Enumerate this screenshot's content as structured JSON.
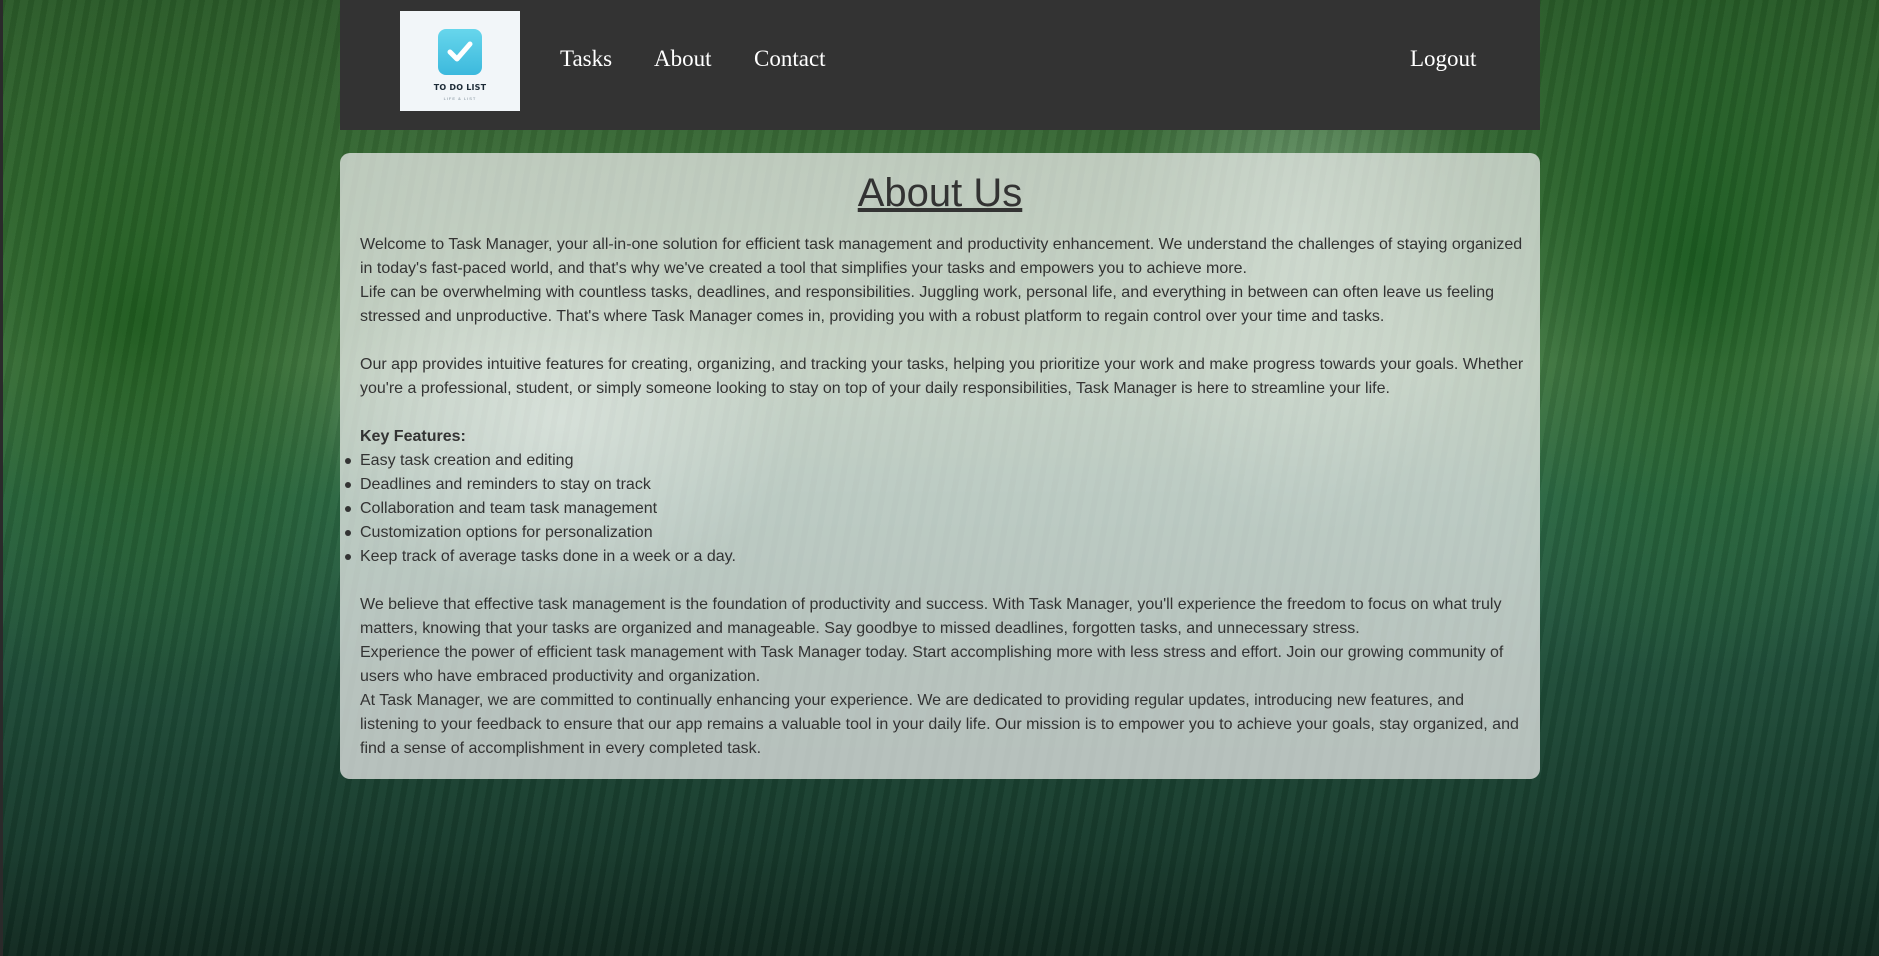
{
  "nav": {
    "logo_text": "TO DO LIST",
    "logo_tagline": "LIFE & LIST",
    "links": [
      "Tasks",
      "About",
      "Contact"
    ],
    "logout": "Logout"
  },
  "about": {
    "title": "About Us",
    "paragraphs_top": [
      "Welcome to Task Manager, your all-in-one solution for efficient task management and productivity enhancement. We understand the challenges of staying organized in today's fast-paced world, and that's why we've created a tool that simplifies your tasks and empowers you to achieve more.",
      "Life can be overwhelming with countless tasks, deadlines, and responsibilities. Juggling work, personal life, and everything in between can often leave us feeling stressed and unproductive. That's where Task Manager comes in, providing you with a robust platform to regain control over your time and tasks.",
      "Our app provides intuitive features for creating, organizing, and tracking your tasks, helping you prioritize your work and make progress towards your goals. Whether you're a professional, student, or simply someone looking to stay on top of your daily responsibilities, Task Manager is here to streamline your life."
    ],
    "features_heading": "Key Features:",
    "features": [
      "Easy task creation and editing",
      "Deadlines and reminders to stay on track",
      "Collaboration and team task management",
      "Customization options for personalization",
      "Keep track of average tasks done in a week or a day."
    ],
    "paragraphs_bottom": [
      "We believe that effective task management is the foundation of productivity and success. With Task Manager, you'll experience the freedom to focus on what truly matters, knowing that your tasks are organized and manageable. Say goodbye to missed deadlines, forgotten tasks, and unnecessary stress.",
      "Experience the power of efficient task management with Task Manager today. Start accomplishing more with less stress and effort. Join our growing community of users who have embraced productivity and organization.",
      "At Task Manager, we are committed to continually enhancing your experience. We are dedicated to providing regular updates, introducing new features, and listening to your feedback to ensure that our app remains a valuable tool in your daily life. Our mission is to empower you to achieve your goals, stay organized, and find a sense of accomplishment in every completed task."
    ]
  },
  "colors": {
    "navbar_bg": "#333333",
    "nav_text": "#ffffff",
    "body_text": "#333333",
    "logo_accent": "#3cb9dd"
  }
}
